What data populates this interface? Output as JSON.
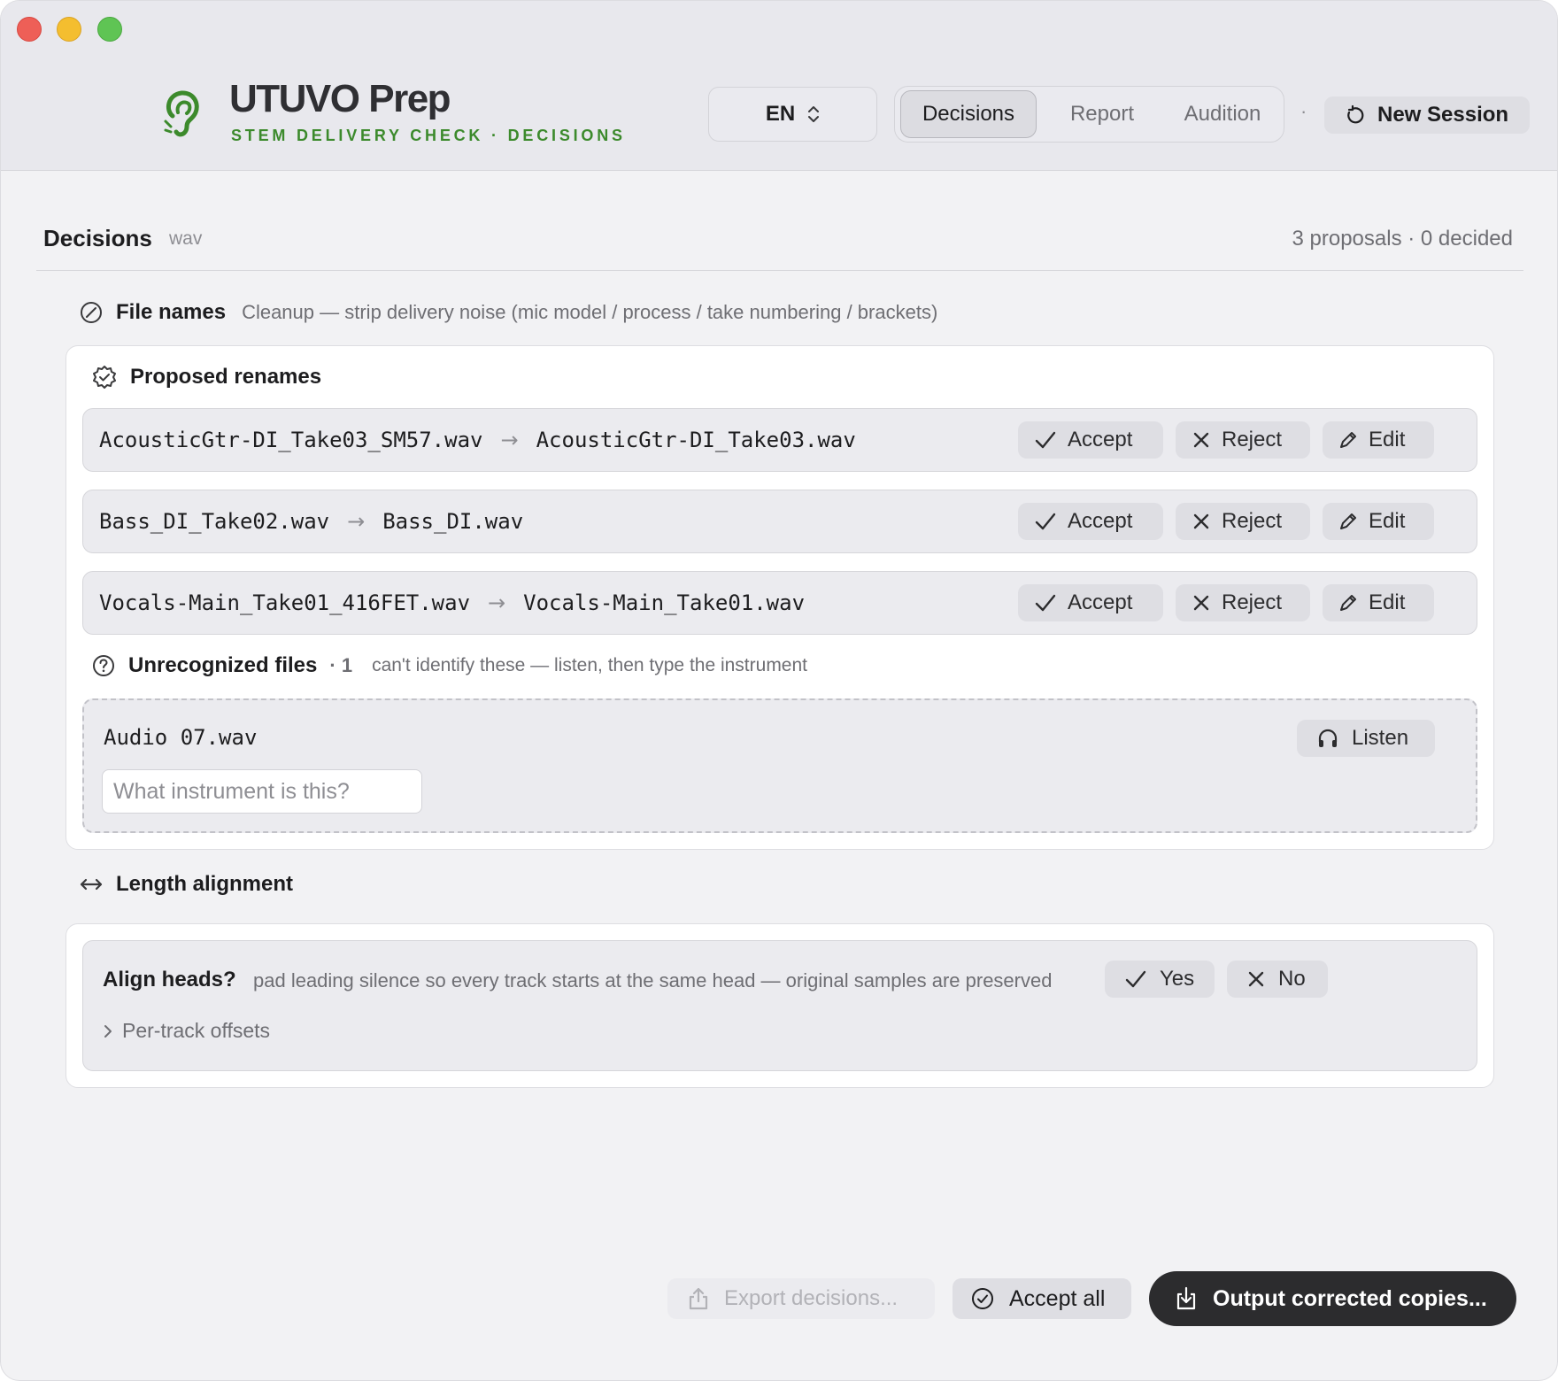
{
  "app": {
    "name": "UTUVO Prep",
    "subtitle": "STEM DELIVERY CHECK · DECISIONS"
  },
  "toolbar": {
    "language": "EN",
    "tabs": [
      {
        "label": "Decisions",
        "active": true
      },
      {
        "label": "Report",
        "active": false
      },
      {
        "label": "Audition",
        "active": false
      }
    ],
    "separator": "·",
    "new_session_label": "New Session"
  },
  "content": {
    "title": "Decisions",
    "format_tag": "wav",
    "stats": "3 proposals · 0 decided"
  },
  "file_names": {
    "title": "File names",
    "description": "Cleanup — strip delivery noise (mic model / process / take numbering / brackets)",
    "proposed_title": "Proposed renames",
    "renames": [
      {
        "from": "AcousticGtr-DI_Take03_SM57.wav",
        "to": "AcousticGtr-DI_Take03.wav"
      },
      {
        "from": "Bass_DI_Take02.wav",
        "to": "Bass_DI.wav"
      },
      {
        "from": "Vocals-Main_Take01_416FET.wav",
        "to": "Vocals-Main_Take01.wav"
      }
    ],
    "actions": {
      "accept": "Accept",
      "reject": "Reject",
      "edit": "Edit"
    },
    "arrow": "→",
    "unrecognized": {
      "title": "Unrecognized files",
      "count": "· 1",
      "description": "can't identify these — listen, then type the instrument",
      "file": "Audio 07.wav",
      "listen_label": "Listen",
      "input_placeholder": "What instrument is this?",
      "input_value": ""
    }
  },
  "length_alignment": {
    "title": "Length alignment",
    "question": "Align heads?",
    "description": "pad leading silence so every track starts at the same head — original samples are preserved",
    "yes_label": "Yes",
    "no_label": "No",
    "offsets_label": "Per-track offsets"
  },
  "footer": {
    "export_label": "Export decisions...",
    "accept_all_label": "Accept all",
    "output_label": "Output corrected copies..."
  },
  "colors": {
    "brand_green": "#3c8a2c",
    "primary_dark": "#2c2c2e",
    "traffic_close": "#ee5f57",
    "traffic_min": "#f4be2f",
    "traffic_max": "#5fc454"
  }
}
